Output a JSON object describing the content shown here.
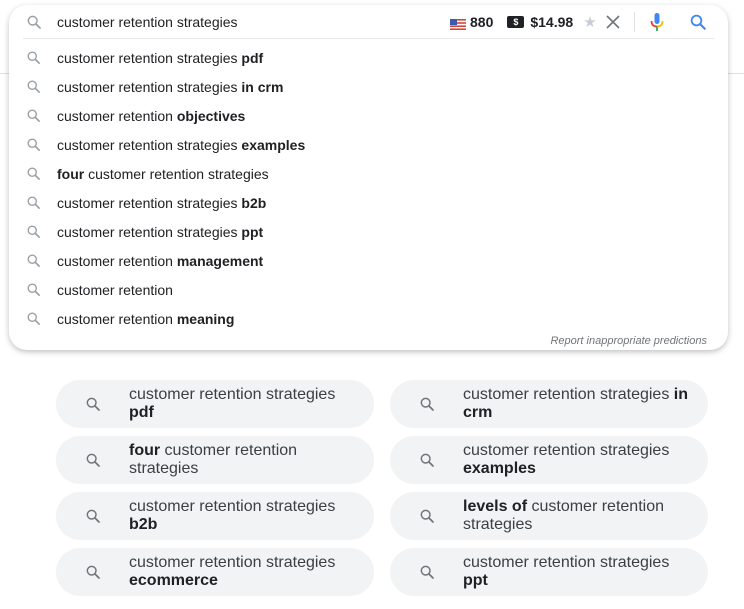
{
  "search": {
    "query": "customer retention strategies",
    "keyword_stats": {
      "country_flag": "us-flag-icon",
      "volume": "880",
      "cpc_badge": "$",
      "cpc": "$14.98"
    },
    "clear_label": "Clear",
    "voice_label": "Search by voice",
    "search_label": "Search"
  },
  "autocomplete": {
    "suggestions": [
      {
        "pre": "customer retention strategies ",
        "bold": "pdf",
        "post": ""
      },
      {
        "pre": "customer retention strategies ",
        "bold": "in crm",
        "post": ""
      },
      {
        "pre": "customer retention ",
        "bold": "objectives",
        "post": ""
      },
      {
        "pre": "customer retention strategies ",
        "bold": "examples",
        "post": ""
      },
      {
        "pre": "",
        "bold": "four",
        "post": " customer retention strategies"
      },
      {
        "pre": "customer retention strategies ",
        "bold": "b2b",
        "post": ""
      },
      {
        "pre": "customer retention strategies ",
        "bold": "ppt",
        "post": ""
      },
      {
        "pre": "customer retention ",
        "bold": "management",
        "post": ""
      },
      {
        "pre": "customer retention",
        "bold": "",
        "post": ""
      },
      {
        "pre": "customer retention ",
        "bold": "meaning",
        "post": ""
      }
    ],
    "report_link": "Report inappropriate predictions"
  },
  "related_searches": [
    {
      "pre": "customer retention strategies ",
      "bold": "pdf",
      "post": ""
    },
    {
      "pre": "customer retention strategies ",
      "bold": "in crm",
      "post": ""
    },
    {
      "pre": "",
      "bold": "four",
      "post": " customer retention strategies"
    },
    {
      "pre": "customer retention strategies ",
      "bold": "examples",
      "post": ""
    },
    {
      "pre": "customer retention strategies ",
      "bold": "b2b",
      "post": ""
    },
    {
      "pre": "",
      "bold": "levels of",
      "post": " customer retention strategies"
    },
    {
      "pre": "customer retention strategies ",
      "bold": "ecommerce",
      "post": ""
    },
    {
      "pre": "customer retention strategies ",
      "bold": "ppt",
      "post": ""
    }
  ],
  "colors": {
    "accent_blue": "#4285f4",
    "chip_bg": "#f1f3f4",
    "icon_gray": "#9aa0a6"
  }
}
